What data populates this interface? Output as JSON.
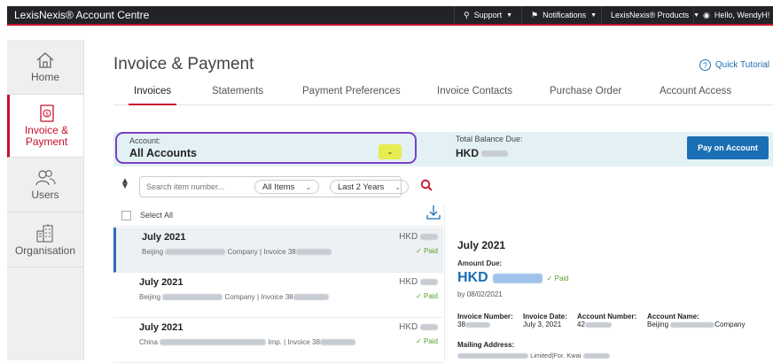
{
  "topbar": {
    "brand": "LexisNexis® Account Centre",
    "support": "Support",
    "notifications": "Notifications",
    "products": "LexisNexis® Products",
    "hello": "Hello, WendyH!"
  },
  "sidebar": {
    "items": [
      {
        "label": "Home"
      },
      {
        "label": "Invoice & Payment"
      },
      {
        "label": "Users"
      },
      {
        "label": "Organisation"
      }
    ]
  },
  "page": {
    "title": "Invoice & Payment",
    "tutorial": "Quick Tutorial"
  },
  "tabs": [
    {
      "label": "Invoices"
    },
    {
      "label": "Statements"
    },
    {
      "label": "Payment Preferences"
    },
    {
      "label": "Invoice Contacts"
    },
    {
      "label": "Purchase Order"
    },
    {
      "label": "Account Access"
    }
  ],
  "account": {
    "label": "Account:",
    "value": "All Accounts",
    "total_label": "Total Balance Due:",
    "total_currency": "HKD",
    "pay_button": "Pay on Account"
  },
  "filters": {
    "search_placeholder": "Search item number...",
    "type": "All Items",
    "period": "Last 2 Years"
  },
  "list": {
    "select_all": "Select All",
    "rows": [
      {
        "date": "July 2021",
        "city": "Beijing",
        "company": "Company | Invoice 38",
        "currency": "HKD",
        "status": "Paid"
      },
      {
        "date": "July 2021",
        "city": "Beijing",
        "company": "Company | Invoice 38",
        "currency": "HKD",
        "status": "Paid"
      },
      {
        "date": "July 2021",
        "city": "China",
        "company": "Imp. | Invoice 38",
        "currency": "HKD",
        "status": "Paid"
      }
    ]
  },
  "detail": {
    "title": "July 2021",
    "amount_label": "Amount Due:",
    "currency": "HKD",
    "status": "Paid",
    "by": "by 08/02/2021",
    "invoice_number_label": "Invoice Number:",
    "invoice_number": "38",
    "invoice_date_label": "Invoice Date:",
    "invoice_date": "July 3, 2021",
    "account_number_label": "Account Number:",
    "account_number": "42",
    "account_name_label": "Account Name:",
    "account_name_city": "Beijing",
    "account_name_suffix": "Company",
    "mailing_label": "Mailing Address:",
    "mailing_value": "Limited|For. Kwai"
  },
  "colors": {
    "brand_red": "#c8102e",
    "link_blue": "#1a6fb5",
    "highlight_purple": "#7b3fc4",
    "paid_green": "#5aa02c"
  }
}
